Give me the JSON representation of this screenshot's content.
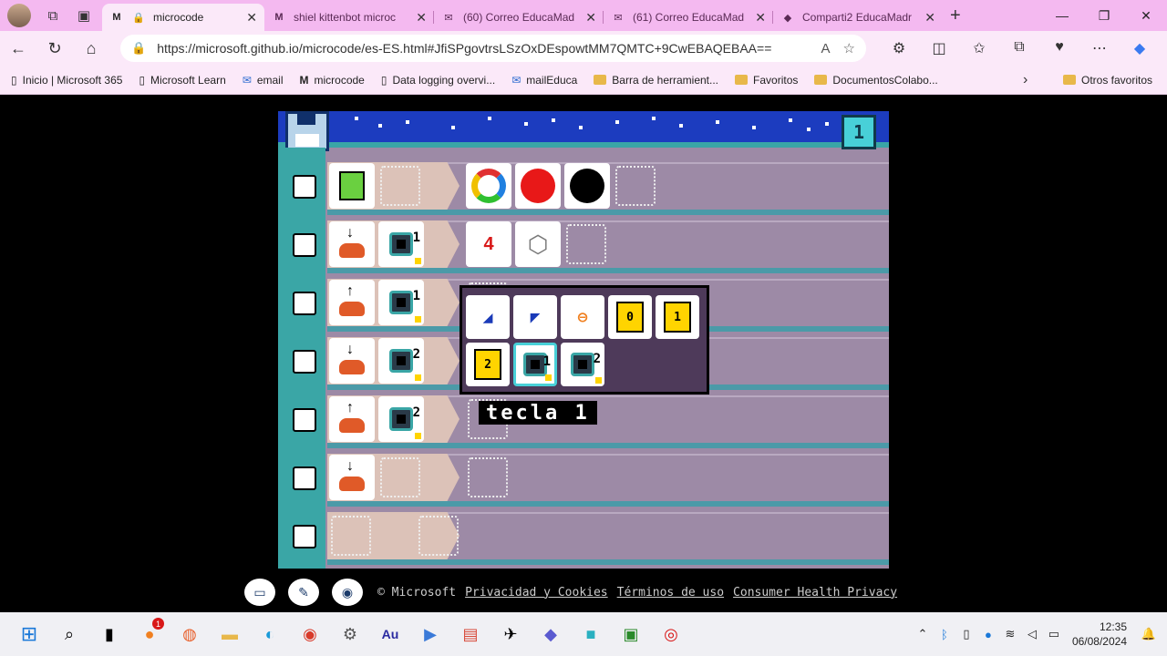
{
  "tabs": [
    {
      "label": "microcode",
      "favicon": "M",
      "active": true
    },
    {
      "label": "shiel kittenbot microc",
      "favicon": "M"
    },
    {
      "label": "(60) Correo EducaMad",
      "favicon": "✉"
    },
    {
      "label": "(61) Correo EducaMad",
      "favicon": "✉"
    },
    {
      "label": "Comparti2 EducaMadr",
      "favicon": "◆"
    }
  ],
  "address": {
    "url": "https://microsoft.github.io/microcode/es-ES.html#JfiSPgovtrsLSzOxDEspowtMM7QMTC+9CwEBAQEBAA=="
  },
  "favorites": [
    {
      "label": "Inicio | Microsoft 365",
      "icon": "page-icon"
    },
    {
      "label": "Microsoft Learn",
      "icon": "page-icon"
    },
    {
      "label": "email",
      "icon": "mail-icon"
    },
    {
      "label": "microcode",
      "icon": "m-icon"
    },
    {
      "label": "Data logging overvi...",
      "icon": "page-icon"
    },
    {
      "label": "mailEduca",
      "icon": "mail-icon"
    },
    {
      "label": "Barra de herramient...",
      "icon": "folder-icon"
    },
    {
      "label": "Favoritos",
      "icon": "folder-icon"
    },
    {
      "label": "DocumentosColabo...",
      "icon": "folder-icon"
    }
  ],
  "favorites_other": "Otros favoritos",
  "game": {
    "page_number": "1",
    "tooltip": "tecla 1",
    "rows": [
      {
        "when": [
          {
            "icon": "green-card-icon"
          }
        ],
        "do": [
          {
            "icon": "rainbow-ring-icon"
          },
          {
            "icon": "red-circle-icon"
          },
          {
            "icon": "black-circle-icon"
          }
        ]
      },
      {
        "when": [
          {
            "icon": "press-down-icon"
          },
          {
            "icon": "key-icon",
            "num": "1"
          }
        ],
        "do": [
          {
            "icon": "counter-4-icon"
          },
          {
            "icon": "dice-icon"
          }
        ]
      },
      {
        "when": [
          {
            "icon": "release-up-icon"
          },
          {
            "icon": "key-icon",
            "num": "1"
          }
        ],
        "do": []
      },
      {
        "when": [
          {
            "icon": "press-down-icon"
          },
          {
            "icon": "key-icon",
            "num": "2"
          }
        ],
        "do": []
      },
      {
        "when": [
          {
            "icon": "release-up-icon"
          },
          {
            "icon": "key-icon",
            "num": "2"
          }
        ],
        "do": []
      },
      {
        "when": [
          {
            "icon": "press-down-icon"
          }
        ],
        "do": []
      },
      {
        "when": [],
        "do": []
      }
    ],
    "picker": [
      {
        "icon": "button-a-icon",
        "text": "A"
      },
      {
        "icon": "button-b-icon",
        "text": "B"
      },
      {
        "icon": "logo-icon",
        "text": ""
      },
      {
        "icon": "pin-0-icon",
        "text": "0"
      },
      {
        "icon": "pin-1-icon",
        "text": "1"
      },
      {
        "icon": "pin-2-icon",
        "text": "2"
      },
      {
        "icon": "key-1-icon",
        "text": "1",
        "selected": true
      },
      {
        "icon": "key-2-icon",
        "text": "2"
      }
    ]
  },
  "footer": {
    "copyright": "© Microsoft",
    "links": [
      "Privacidad y Cookies",
      "Términos de uso",
      "Consumer Health Privacy"
    ]
  },
  "taskbar": {
    "time": "12:35",
    "date": "06/08/2024",
    "badge": "1"
  },
  "colors": {
    "tab_bg": "#f4b9f0",
    "toolbar_bg": "#fbe9f9",
    "game_bg": "#9d8aa6",
    "sky": "#1c3cbf",
    "teal": "#3aa6a6"
  }
}
